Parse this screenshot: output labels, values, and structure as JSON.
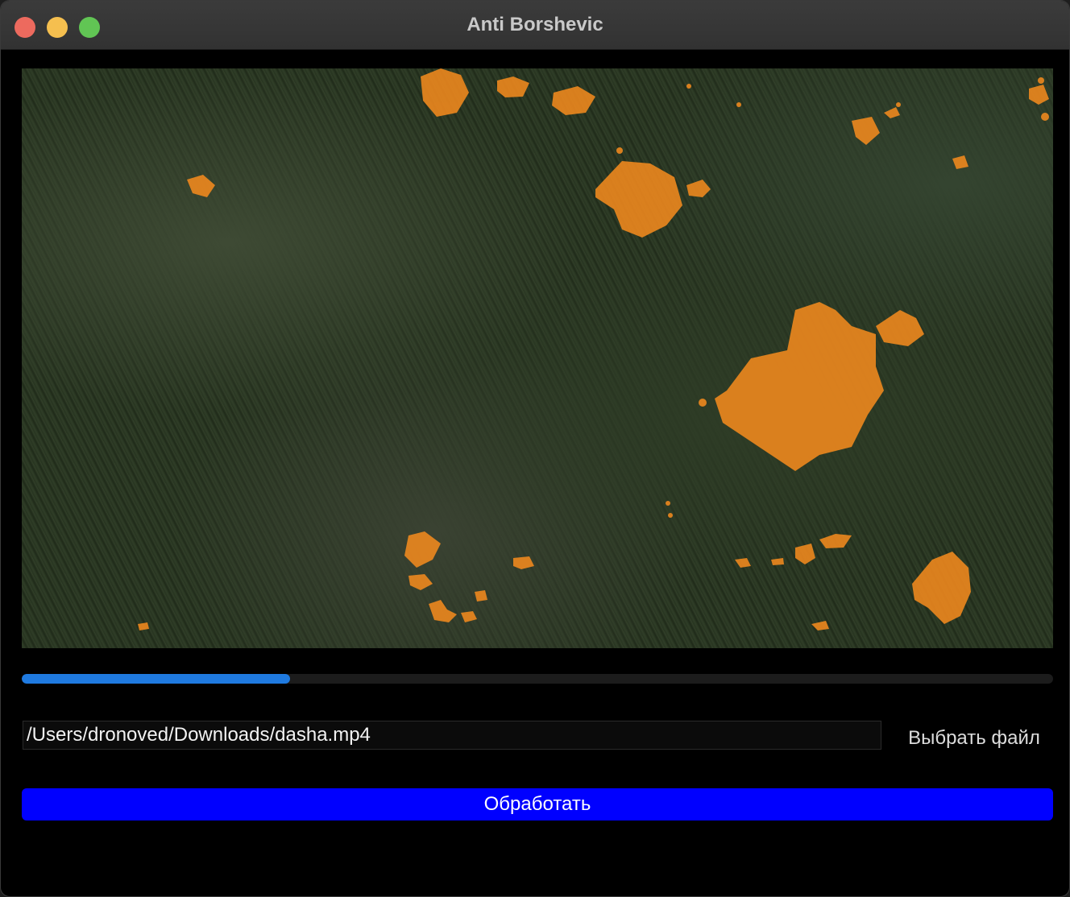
{
  "window": {
    "title": "Anti Borshevic",
    "buttons": [
      "close",
      "minimize",
      "maximize"
    ]
  },
  "preview": {
    "overlay_color": "#f28a1e"
  },
  "progress": {
    "fraction": 0.26
  },
  "file": {
    "path_value": "/Users/dronoved/Downloads/dasha.mp4",
    "choose_label": "Выбрать файл"
  },
  "actions": {
    "process_label": "Обработать"
  },
  "colors": {
    "accent_progress": "#1f7ae0",
    "process_button": "#0000ff"
  }
}
